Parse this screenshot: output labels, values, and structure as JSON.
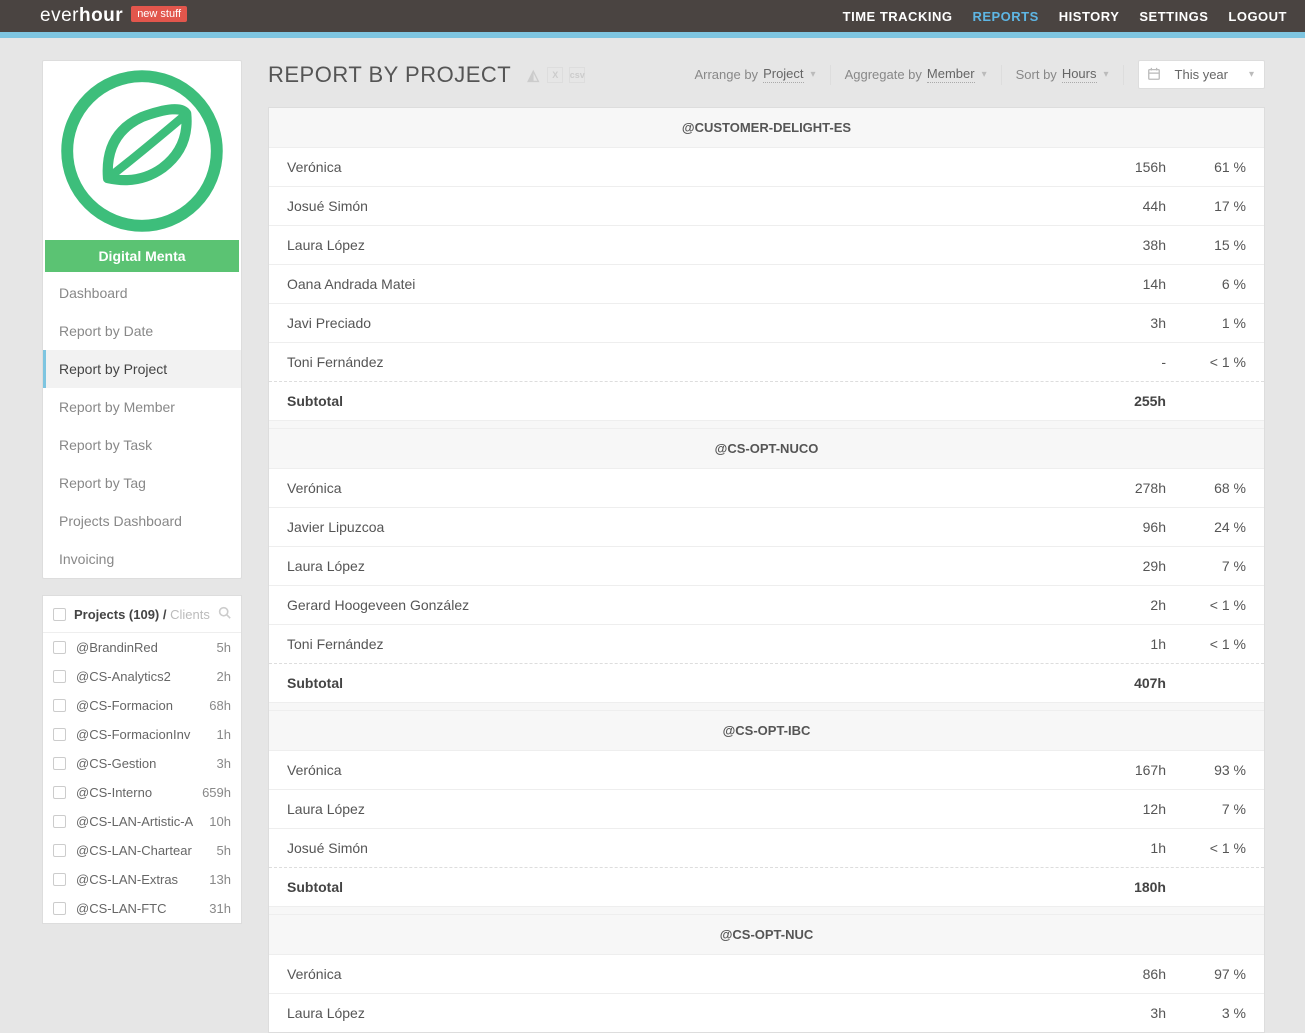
{
  "brand": {
    "prefix": "ever",
    "suffix": "hour",
    "badge": "new stuff"
  },
  "topnav": {
    "time_tracking": "TIME TRACKING",
    "reports": "REPORTS",
    "history": "HISTORY",
    "settings": "SETTINGS",
    "logout": "LOGOUT"
  },
  "org": {
    "name": "Digital Menta"
  },
  "sidebar": {
    "items": [
      {
        "label": "Dashboard"
      },
      {
        "label": "Report by Date"
      },
      {
        "label": "Report by Project"
      },
      {
        "label": "Report by Member"
      },
      {
        "label": "Report by Task"
      },
      {
        "label": "Report by Tag"
      },
      {
        "label": "Projects Dashboard"
      },
      {
        "label": "Invoicing"
      }
    ]
  },
  "projects_panel": {
    "title": "Projects (109) /",
    "clients": "Clients",
    "items": [
      {
        "name": "@BrandinRed",
        "hours": "5h"
      },
      {
        "name": "@CS-Analytics2",
        "hours": "2h"
      },
      {
        "name": "@CS-Formacion",
        "hours": "68h"
      },
      {
        "name": "@CS-FormacionInv",
        "hours": "1h"
      },
      {
        "name": "@CS-Gestion",
        "hours": "3h"
      },
      {
        "name": "@CS-Interno",
        "hours": "659h"
      },
      {
        "name": "@CS-LAN-Artistic-A",
        "hours": "10h"
      },
      {
        "name": "@CS-LAN-Chartear",
        "hours": "5h"
      },
      {
        "name": "@CS-LAN-Extras",
        "hours": "13h"
      },
      {
        "name": "@CS-LAN-FTC",
        "hours": "31h"
      }
    ]
  },
  "header": {
    "title": "REPORT BY PROJECT",
    "arrange_label": "Arrange by",
    "arrange_value": "Project",
    "aggregate_label": "Aggregate by",
    "aggregate_value": "Member",
    "sort_label": "Sort by",
    "sort_value": "Hours",
    "date_value": "This year"
  },
  "groups": [
    {
      "title": "@CUSTOMER-DELIGHT-ES",
      "rows": [
        {
          "name": "Verónica",
          "hours": "156h",
          "pct": "61 %"
        },
        {
          "name": "Josué Simón",
          "hours": "44h",
          "pct": "17 %"
        },
        {
          "name": "Laura López",
          "hours": "38h",
          "pct": "15 %"
        },
        {
          "name": "Oana Andrada Matei",
          "hours": "14h",
          "pct": "6 %"
        },
        {
          "name": "Javi Preciado",
          "hours": "3h",
          "pct": "1 %"
        },
        {
          "name": "Toni Fernández",
          "hours": "-",
          "pct": "< 1 %"
        }
      ],
      "subtotal_label": "Subtotal",
      "subtotal_hours": "255h"
    },
    {
      "title": "@CS-OPT-NUCO",
      "rows": [
        {
          "name": "Verónica",
          "hours": "278h",
          "pct": "68 %"
        },
        {
          "name": "Javier Lipuzcoa",
          "hours": "96h",
          "pct": "24 %"
        },
        {
          "name": "Laura López",
          "hours": "29h",
          "pct": "7 %"
        },
        {
          "name": "Gerard Hoogeveen González",
          "hours": "2h",
          "pct": "< 1 %"
        },
        {
          "name": "Toni Fernández",
          "hours": "1h",
          "pct": "< 1 %"
        }
      ],
      "subtotal_label": "Subtotal",
      "subtotal_hours": "407h"
    },
    {
      "title": "@CS-OPT-IBC",
      "rows": [
        {
          "name": "Verónica",
          "hours": "167h",
          "pct": "93 %"
        },
        {
          "name": "Laura López",
          "hours": "12h",
          "pct": "7 %"
        },
        {
          "name": "Josué Simón",
          "hours": "1h",
          "pct": "< 1 %"
        }
      ],
      "subtotal_label": "Subtotal",
      "subtotal_hours": "180h"
    },
    {
      "title": "@CS-OPT-NUC",
      "rows": [
        {
          "name": "Verónica",
          "hours": "86h",
          "pct": "97 %"
        },
        {
          "name": "Laura López",
          "hours": "3h",
          "pct": "3 %"
        }
      ],
      "subtotal_label": "",
      "subtotal_hours": ""
    }
  ]
}
